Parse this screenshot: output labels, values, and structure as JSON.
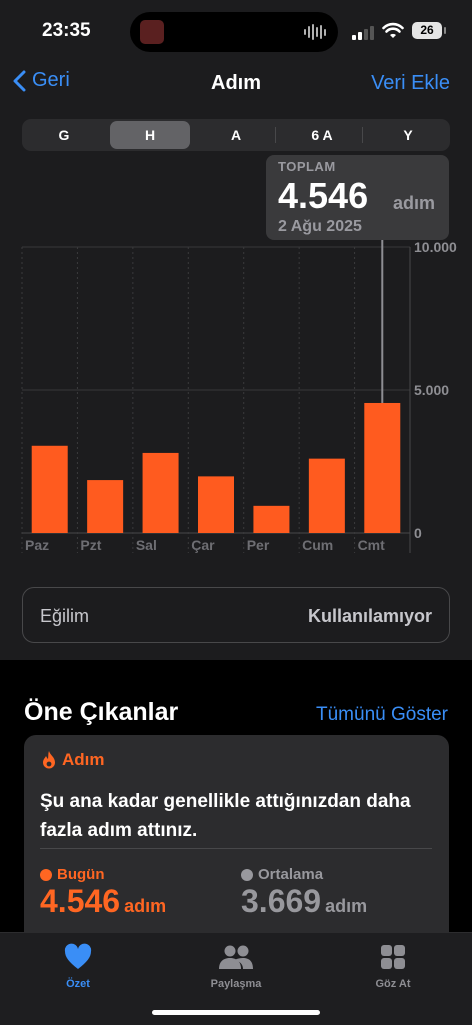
{
  "status": {
    "time": "23:35",
    "battery": "26"
  },
  "nav": {
    "back_label": "Geri",
    "title": "Adım",
    "action_label": "Veri Ekle"
  },
  "segments": [
    "G",
    "H",
    "A",
    "6 A",
    "Y"
  ],
  "selected_segment": "H",
  "callout": {
    "label": "TOPLAM",
    "value": "4.546",
    "unit": "adım",
    "date": "2 Ağu 2025"
  },
  "chart_data": {
    "type": "bar",
    "categories": [
      "Paz",
      "Pzt",
      "Sal",
      "Çar",
      "Per",
      "Cum",
      "Cmt"
    ],
    "values": [
      3050,
      1850,
      2800,
      1980,
      950,
      2600,
      4546
    ],
    "ylim": [
      0,
      10000
    ],
    "yticks": [
      "0",
      "5.000",
      "10.000"
    ],
    "grid": true,
    "bar_color": "#ff5b1f",
    "selected_index": 6
  },
  "trend": {
    "label": "Eğilim",
    "value": "Kullanılamıyor"
  },
  "highlights": {
    "title": "Öne Çıkanlar",
    "link": "Tümünü Göster",
    "category": "Adım",
    "text": "Şu ana kadar genellikle attığınızdan daha fazla adım attınız.",
    "today": {
      "label": "Bugün",
      "value": "4.546",
      "unit": "adım",
      "color": "#ff6622"
    },
    "average": {
      "label": "Ortalama",
      "value": "3.669",
      "unit": "adım",
      "color": "#98989d"
    }
  },
  "tabs": [
    {
      "label": "Özet",
      "icon": "heart-icon",
      "active": true
    },
    {
      "label": "Paylaşma",
      "icon": "people-icon",
      "active": false
    },
    {
      "label": "Göz At",
      "icon": "grid-icon",
      "active": false
    }
  ],
  "colors": {
    "accent": "#3a8ef6",
    "bar": "#ff5b1f"
  }
}
